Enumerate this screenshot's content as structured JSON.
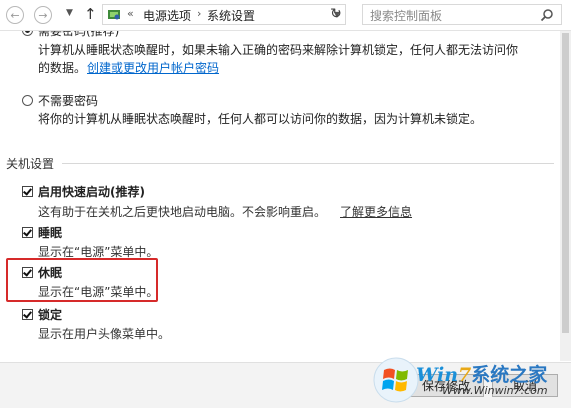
{
  "address_bar": {
    "breadcrumb_prefix": "«",
    "crumbs": [
      "电源选项",
      "系统设置"
    ],
    "separator": "›",
    "search_placeholder": "搜索控制面板"
  },
  "password_section": {
    "truncated_top_label": "需要密码(推荐)",
    "require_password_desc_1": "计算机从睡眠状态唤醒时，如果未输入正确的密码来解除计算机锁定，任何人都无法访问你",
    "require_password_desc_2": "的数据。",
    "require_password_link": "创建或更改用户帐户密码",
    "no_password_label": "不需要密码",
    "no_password_desc": "将你的计算机从睡眠状态唤醒时，任何人都可以访问你的数据，因为计算机未锁定。"
  },
  "shutdown_settings": {
    "title": "关机设置",
    "items": [
      {
        "label": "启用快速启动(推荐)",
        "desc": "这有助于在关机之后更快地启动电脑。不会影响重启。",
        "link": "了解更多信息",
        "checked": true
      },
      {
        "label": "睡眠",
        "desc": "显示在“电源”菜单中。",
        "checked": true
      },
      {
        "label": "休眠",
        "desc": "显示在“电源”菜单中。",
        "checked": true
      },
      {
        "label": "锁定",
        "desc": "显示在用户头像菜单中。",
        "checked": true
      }
    ]
  },
  "footer": {
    "save_label": "保存修改",
    "cancel_label": "取消"
  },
  "watermark": {
    "brand_win": "Win",
    "brand_seven": "7",
    "brand_cn": "系统之家",
    "url": "Www.Winwin7.com"
  },
  "colors": {
    "link": "#0066cc",
    "highlight": "#d62a2a",
    "brand_blue": "#1a8fd8",
    "brand_orange": "#e8a817"
  }
}
